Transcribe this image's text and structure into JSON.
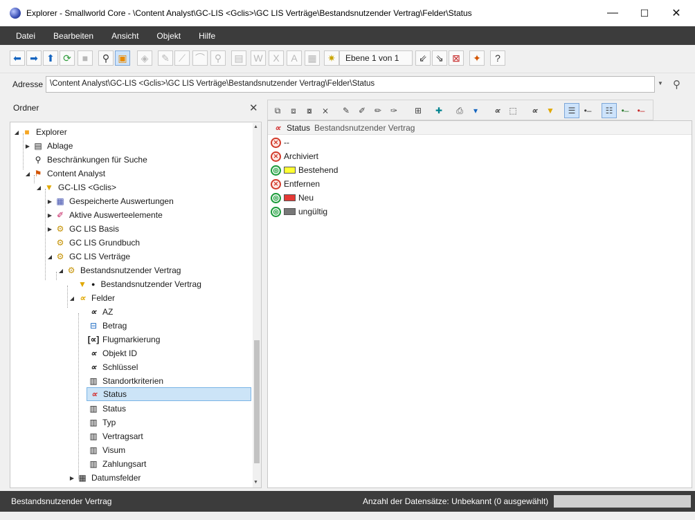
{
  "window": {
    "title": "Explorer - Smallworld Core - \\Content Analyst\\GC-LIS <Gclis>\\GC LIS Verträge\\Bestandsnutzender Vertrag\\Felder\\Status",
    "minimize": "—",
    "maximize": "☐",
    "close": "✕"
  },
  "menu": [
    "Datei",
    "Bearbeiten",
    "Ansicht",
    "Objekt",
    "Hilfe"
  ],
  "toolbar": {
    "ebene_label": "Ebene 1 von 1"
  },
  "address": {
    "label": "Adresse",
    "value": "\\Content Analyst\\GC-LIS <Gclis>\\GC LIS Verträge\\Bestandsnutzender Vertrag\\Felder\\Status"
  },
  "left_panel": {
    "title": "Ordner",
    "close": "✕",
    "tree": [
      {
        "label": "Explorer",
        "icon": "folder-icon"
      },
      {
        "label": "Ablage",
        "icon": "storage-icon"
      },
      {
        "label": "Beschränkungen für Suche",
        "icon": "search-icon"
      },
      {
        "label": "Content Analyst",
        "icon": "analyst-icon"
      },
      {
        "label": "GC-LIS <Gclis>",
        "icon": "filter-icon"
      },
      {
        "label": "Gespeicherte Auswertungen",
        "icon": "saved-reports-icon"
      },
      {
        "label": "Aktive Auswerteelemente",
        "icon": "active-elements-icon"
      },
      {
        "label": "GC LIS Basis",
        "icon": "folder-gear-icon"
      },
      {
        "label": "GC LIS Grundbuch",
        "icon": "folder-gear-icon"
      },
      {
        "label": "GC LIS Verträge",
        "icon": "folder-gear-icon"
      },
      {
        "label": "Bestandsnutzender Vertrag",
        "icon": "folder-gear-icon"
      },
      {
        "label": "Bestandsnutzender Vertrag",
        "icon": "filter-icon"
      },
      {
        "label": "Felder",
        "icon": "field-alpha-icon"
      },
      {
        "label": "AZ",
        "icon": "field-alpha-icon"
      },
      {
        "label": "Betrag",
        "icon": "field-number-icon"
      },
      {
        "label": "Flugmarkierung",
        "icon": "field-bracket-icon"
      },
      {
        "label": "Objekt ID",
        "icon": "field-alpha-icon"
      },
      {
        "label": "Schlüssel",
        "icon": "field-alpha-icon"
      },
      {
        "label": "Standortkriterien",
        "icon": "book-icon"
      },
      {
        "label": "Status",
        "icon": "field-alpha-red-icon"
      },
      {
        "label": "Status",
        "icon": "book-icon"
      },
      {
        "label": "Typ",
        "icon": "book-icon"
      },
      {
        "label": "Vertragsart",
        "icon": "book-icon"
      },
      {
        "label": "Visum",
        "icon": "book-icon"
      },
      {
        "label": "Zahlungsart",
        "icon": "book-icon"
      },
      {
        "label": "Datumsfelder",
        "icon": "calendar-icon"
      }
    ]
  },
  "right_panel": {
    "header_title": "Status",
    "header_sub": "Bestandsnutzender Vertrag",
    "items": [
      {
        "label": "--",
        "state": "red",
        "swatch": ""
      },
      {
        "label": "Archiviert",
        "state": "red",
        "swatch": ""
      },
      {
        "label": "Bestehend",
        "state": "green",
        "swatch": "#ffff33"
      },
      {
        "label": "Entfernen",
        "state": "red",
        "swatch": ""
      },
      {
        "label": "Neu",
        "state": "green",
        "swatch": "#e53935"
      },
      {
        "label": "ungültig",
        "state": "green",
        "swatch": "#777777"
      }
    ]
  },
  "status_bar": {
    "left": "Bestandsnutzender Vertrag",
    "right": "Anzahl der Datensätze: Unbekannt (0 ausgewählt)"
  }
}
